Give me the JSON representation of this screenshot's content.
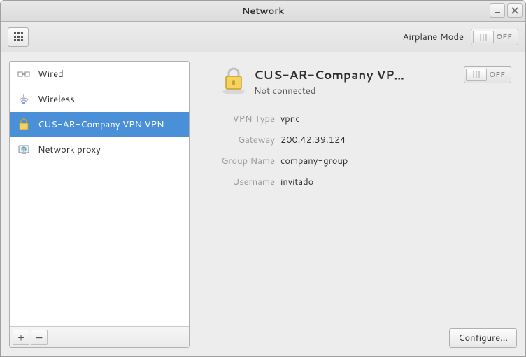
{
  "window": {
    "title": "Network"
  },
  "toolbar": {
    "airplane_label": "Airplane Mode",
    "airplane_state": "OFF"
  },
  "sidebar": {
    "items": [
      {
        "icon": "wired-icon",
        "label": "Wired"
      },
      {
        "icon": "wireless-icon",
        "label": "Wireless"
      },
      {
        "icon": "vpn-lock-icon",
        "label": "CUS-AR-Company VPN VPN"
      },
      {
        "icon": "proxy-icon",
        "label": "Network proxy"
      }
    ],
    "selected_index": 2,
    "add_label": "+",
    "remove_label": "−"
  },
  "detail": {
    "title": "CUS-AR-Company VPN V...",
    "status": "Not connected",
    "switch_state": "OFF",
    "props": [
      {
        "label": "VPN Type",
        "value": "vpnc"
      },
      {
        "label": "Gateway",
        "value": "200.42.39.124"
      },
      {
        "label": "Group Name",
        "value": "company-group"
      },
      {
        "label": "Username",
        "value": "invitado"
      }
    ],
    "configure_label": "Configure..."
  }
}
